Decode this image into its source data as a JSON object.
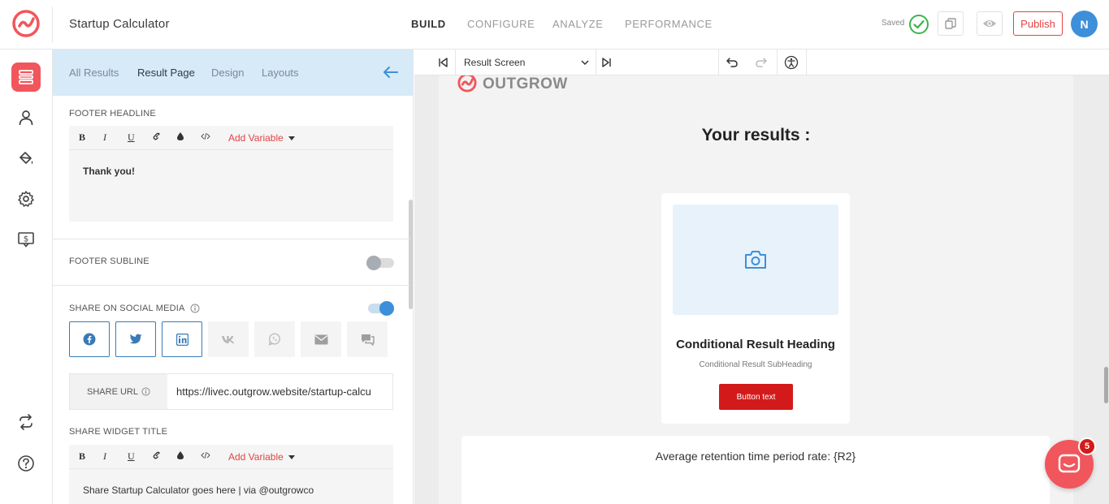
{
  "app": {
    "title": "Startup Calculator"
  },
  "nav": {
    "build": "BUILD",
    "configure": "CONFIGURE",
    "analyze": "ANALYZE",
    "performance": "PERFORMANCE"
  },
  "header": {
    "saved": "Saved",
    "publish": "Publish",
    "avatar": "N"
  },
  "colors": {
    "accent": "#f1565c",
    "primary_blue": "#3e8fd9",
    "publish_red": "#e24444",
    "button_red": "#d31a1a"
  },
  "panel": {
    "tabs": [
      "All Results",
      "Result Page",
      "Design",
      "Layouts"
    ],
    "active_tab": "Result Page",
    "footer_headline": {
      "label": "FOOTER HEADLINE",
      "text": "Thank you!"
    },
    "toolbar": {
      "bold": "B",
      "italic": "I",
      "underline": "U",
      "add_variable": "Add Variable"
    },
    "footer_subline": {
      "label": "FOOTER SUBLINE",
      "enabled": false
    },
    "share_social": {
      "label": "SHARE ON SOCIAL MEDIA",
      "enabled": true
    },
    "social_icons": [
      {
        "name": "facebook-icon",
        "active": true
      },
      {
        "name": "twitter-icon",
        "active": true
      },
      {
        "name": "linkedin-icon",
        "active": true
      },
      {
        "name": "vk-icon",
        "active": false
      },
      {
        "name": "whatsapp-icon",
        "active": false
      },
      {
        "name": "email-icon",
        "active": false
      },
      {
        "name": "chat-icon",
        "active": false
      }
    ],
    "share_url": {
      "label": "SHARE URL",
      "value": "https://livec.outgrow.website/startup-calcu"
    },
    "share_widget_title": {
      "label": "SHARE WIDGET TITLE",
      "text": "Share Startup Calculator goes here | via @outgrowco"
    }
  },
  "preview": {
    "screen_select": "Result Screen",
    "logo_text": "OUTGROW",
    "results_title": "Your results :",
    "card_heading": "Conditional Result Heading",
    "card_subheading": "Conditional Result SubHeading",
    "card_button": "Button text",
    "avg_text": "Average retention time period rate: {R2}"
  },
  "chat": {
    "badge": "5"
  }
}
